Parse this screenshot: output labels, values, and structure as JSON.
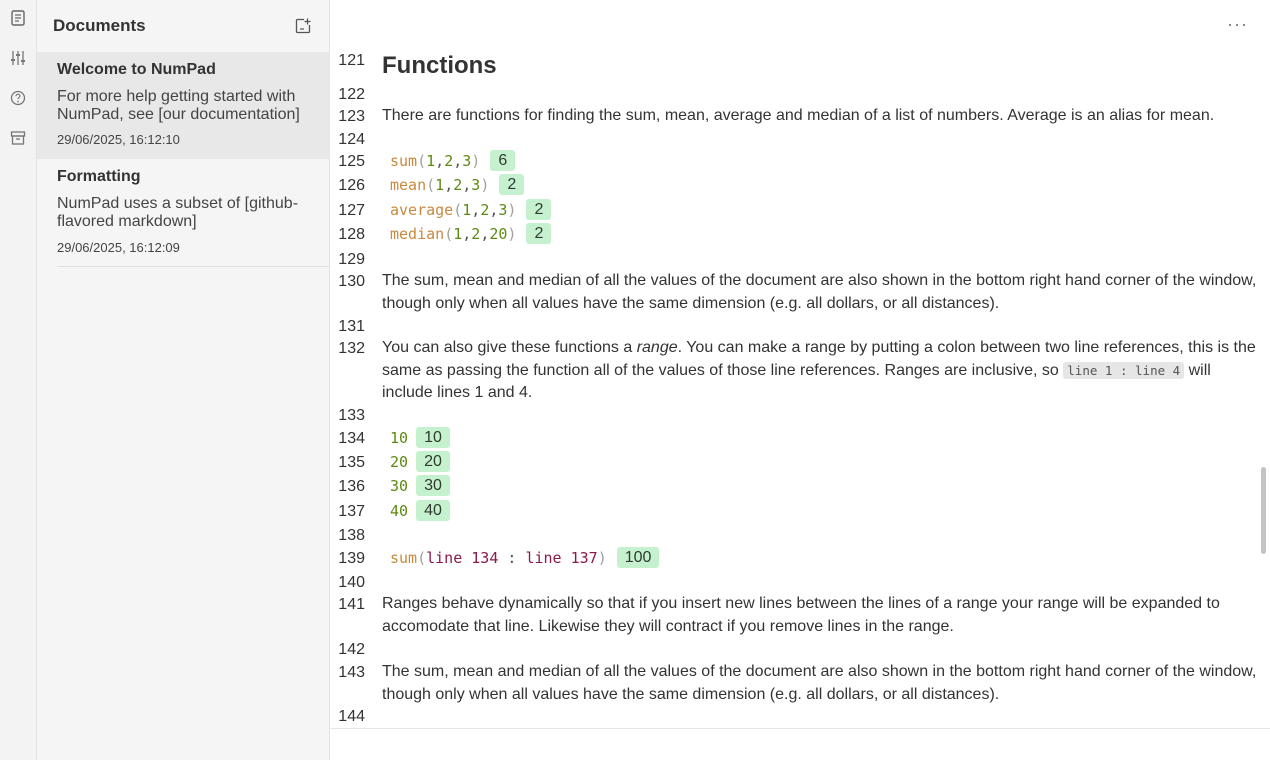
{
  "rail": {
    "icons": [
      "document-icon",
      "sliders-icon",
      "help-icon",
      "archive-icon"
    ]
  },
  "sidebar": {
    "title": "Documents",
    "documents": [
      {
        "title": "Welcome to NumPad",
        "snippet": "For more help getting started with NumPad, see [our documentation]",
        "date": "29/06/2025, 16:12:10"
      },
      {
        "title": "Formatting",
        "snippet": "NumPad uses a subset of [github-flavored markdown]",
        "date": "29/06/2025, 16:12:09"
      }
    ]
  },
  "editor": {
    "menu_label": "···",
    "lines": {
      "l121": "121",
      "l122": "122",
      "l123": "123",
      "l124": "124",
      "l125": "125",
      "l126": "126",
      "l127": "127",
      "l128": "128",
      "l129": "129",
      "l130": "130",
      "l131": "131",
      "l132": "132",
      "l133": "133",
      "l134": "134",
      "l135": "135",
      "l136": "136",
      "l137": "137",
      "l138": "138",
      "l139": "139",
      "l140": "140",
      "l141": "141",
      "l142": "142",
      "l143": "143",
      "l144": "144"
    },
    "heading": "Functions",
    "p123": "There are functions for finding the sum, mean, average and median of a list of numbers. Average is an alias for mean.",
    "code": {
      "c125": {
        "fn": "sum",
        "a": "1",
        "b": "2",
        "c": "3",
        "result": "6"
      },
      "c126": {
        "fn": "mean",
        "a": "1",
        "b": "2",
        "c": "3",
        "result": "2"
      },
      "c127": {
        "fn": "average",
        "a": "1",
        "b": "2",
        "c": "3",
        "result": "2"
      },
      "c128": {
        "fn": "median",
        "a": "1",
        "b": "2",
        "c": "20",
        "result": "2"
      },
      "c134": {
        "value": "10",
        "result": "10"
      },
      "c135": {
        "value": "20",
        "result": "20"
      },
      "c136": {
        "value": "30",
        "result": "30"
      },
      "c137": {
        "value": "40",
        "result": "40"
      },
      "c139": {
        "fn": "sum",
        "from": "line 134",
        "sep": ":",
        "to": "line 137",
        "result": "100"
      }
    },
    "p130": "The sum, mean and median of all the values of the document are also shown in the bottom right hand corner of the window, though only when all values have the same dimension (e.g. all dollars, or all distances).",
    "p132_a": "You can also give these functions a ",
    "p132_em": "range",
    "p132_b": ". You can make a range by putting a colon between two line references, this is the same as passing the function all of the values of those line references. Ranges are inclusive, so ",
    "p132_code": "line 1 : line 4",
    "p132_c": " will include lines 1 and 4.",
    "p141": "Ranges behave dynamically so that if you insert new lines between the lines of a range your range will be expanded to accomodate that line. Likewise they will contract if you remove lines in the range.",
    "p143": "The sum, mean and median of all the values of the document are also shown in the bottom right hand corner of the window, though only when all values have the same dimension (e.g. all dollars, or all distances)."
  }
}
